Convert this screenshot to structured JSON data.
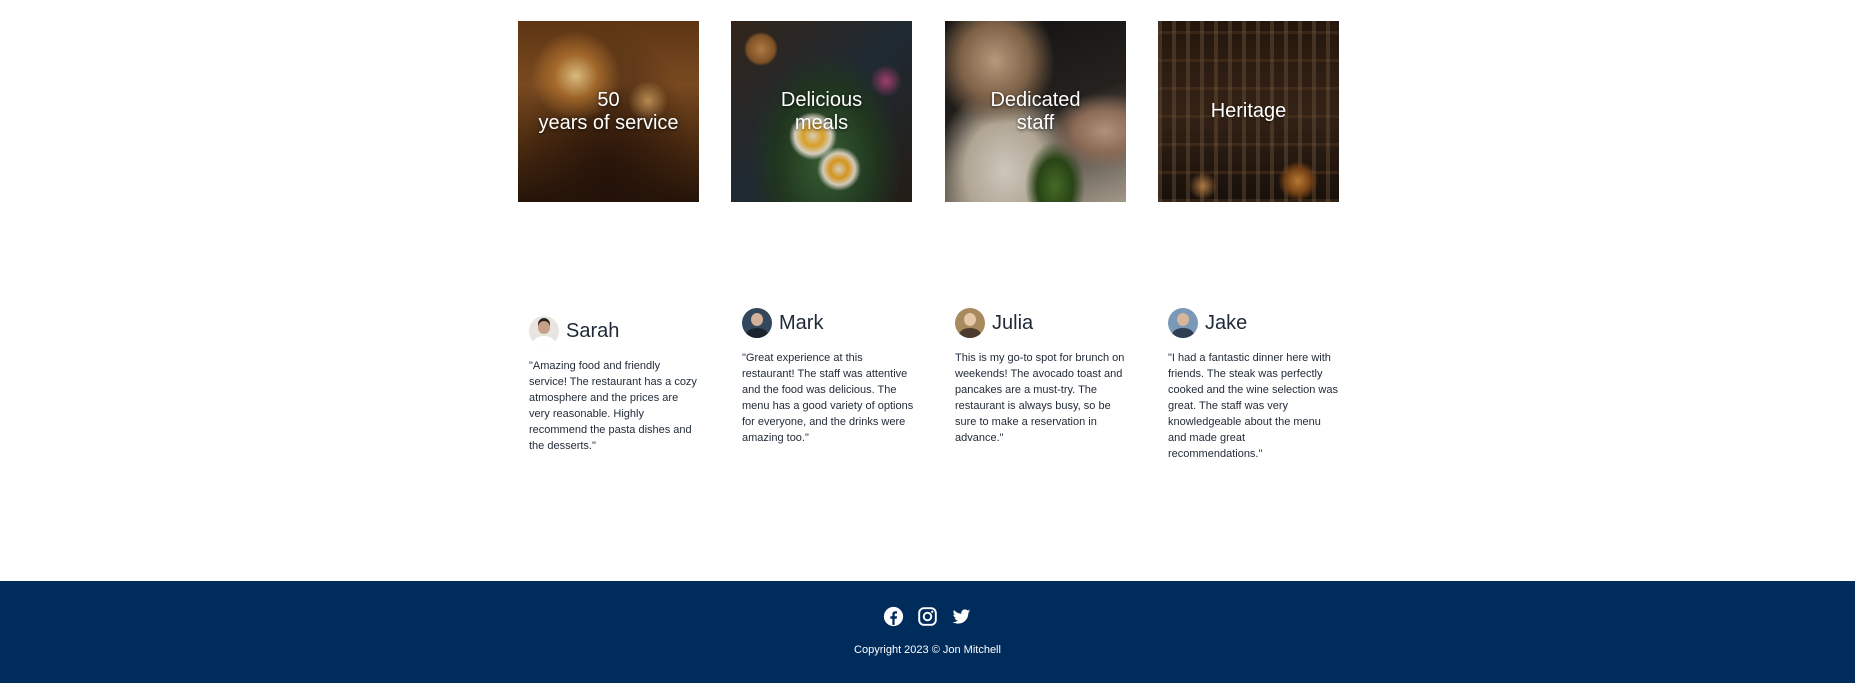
{
  "features": [
    {
      "lines": [
        "50",
        "years of service"
      ]
    },
    {
      "lines": [
        "Delicious",
        "meals"
      ]
    },
    {
      "lines": [
        "Dedicated",
        "staff"
      ]
    },
    {
      "lines": [
        "Heritage"
      ]
    }
  ],
  "testimonials": [
    {
      "name": "Sarah",
      "text": "\"Amazing food and friendly service! The restaurant has a cozy atmosphere and the prices are very reasonable. Highly recommend the pasta dishes and the desserts.\""
    },
    {
      "name": "Mark",
      "text": "\"Great experience at this restaurant! The staff was attentive and the food was delicious. The menu has a good variety of options for everyone, and the drinks were amazing too.\""
    },
    {
      "name": "Julia",
      "text": "This is my go-to spot for brunch on weekends! The avocado toast and pancakes are a must-try. The restaurant is always busy, so be sure to make a reservation in advance.\""
    },
    {
      "name": "Jake",
      "text": "\"I had a fantastic dinner here with friends. The steak was perfectly cooked and the wine selection was great. The staff was very knowledgeable about the menu and made great recommendations.\""
    }
  ],
  "footer": {
    "social_icons": [
      "facebook-icon",
      "instagram-icon",
      "twitter-icon"
    ],
    "copyright": "Copyright 2023 © Jon Mitchell",
    "background_color": "#002c5b"
  }
}
